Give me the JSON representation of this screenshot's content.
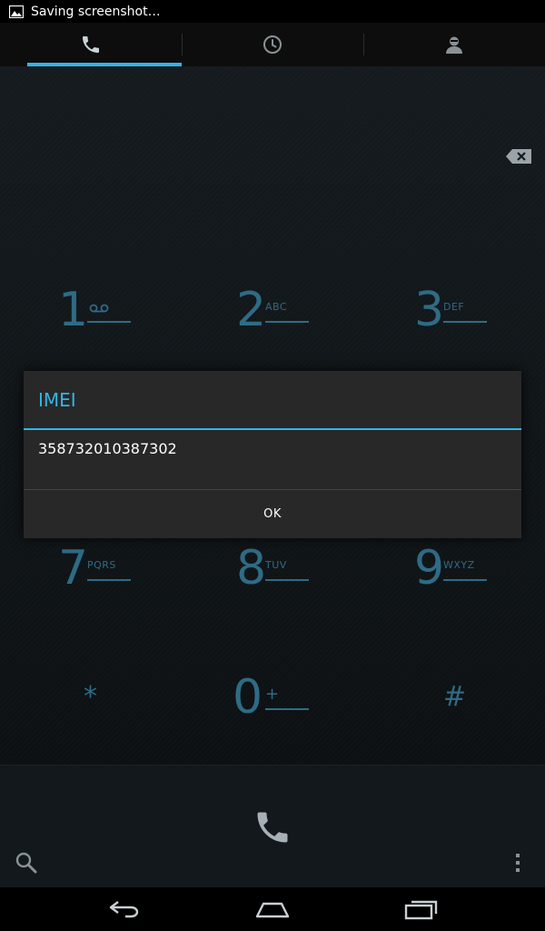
{
  "status_bar": {
    "notification_text": "Saving screenshot…",
    "notification_icon": "image-icon"
  },
  "tabs": [
    {
      "name": "phone",
      "icon": "phone-icon",
      "active": true
    },
    {
      "name": "call-log",
      "icon": "clock-icon",
      "active": false
    },
    {
      "name": "contacts",
      "icon": "contact-icon",
      "active": false
    }
  ],
  "keypad": {
    "keys": [
      {
        "digit": "1",
        "letters": ""
      },
      {
        "digit": "2",
        "letters": "ABC"
      },
      {
        "digit": "3",
        "letters": "DEF"
      },
      {
        "digit": "7",
        "letters": "PQRS"
      },
      {
        "digit": "8",
        "letters": "TUV"
      },
      {
        "digit": "9",
        "letters": "WXYZ"
      },
      {
        "digit": "*",
        "letters": ""
      },
      {
        "digit": "0",
        "letters": "+"
      },
      {
        "digit": "#",
        "letters": ""
      }
    ]
  },
  "dialog": {
    "title": "IMEI",
    "message": "358732010387302",
    "ok_label": "OK"
  },
  "colors": {
    "accent": "#33b5e5",
    "key_text": "#2f6b85",
    "dialog_bg": "#282828"
  },
  "icons": {
    "backspace": "backspace-icon",
    "call": "call-icon",
    "search": "search-icon",
    "overflow": "overflow-menu-icon",
    "nav_back": "back-icon",
    "nav_home": "home-icon",
    "nav_recents": "recents-icon"
  }
}
